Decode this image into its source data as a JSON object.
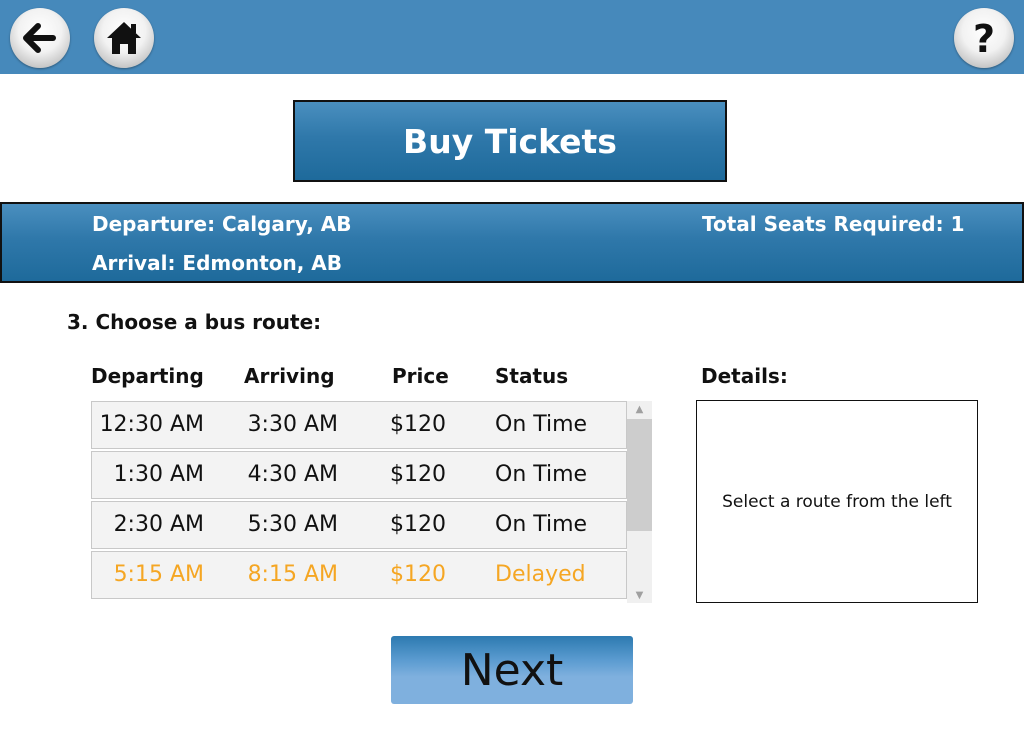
{
  "topbar": {
    "back_icon": "arrow-left-icon",
    "home_icon": "home-icon",
    "help_label": "?",
    "bar_color": "#4689bb"
  },
  "header": {
    "title": "Buy Tickets"
  },
  "trip_info": {
    "departure": "Departure: Calgary, AB",
    "arrival": "Arrival: Edmonton, AB",
    "seats": "Total Seats Required: 1"
  },
  "step": {
    "label": "3. Choose a bus route:"
  },
  "routes": {
    "columns": [
      "Departing",
      "Arriving",
      "Price",
      "Status"
    ],
    "rows": [
      {
        "departing": "12:30 AM",
        "arriving": "3:30 AM",
        "price": "$120",
        "status": "On Time"
      },
      {
        "departing": "1:30 AM",
        "arriving": "4:30 AM",
        "price": "$120",
        "status": "On Time"
      },
      {
        "departing": "2:30 AM",
        "arriving": "5:30 AM",
        "price": "$120",
        "status": "On Time"
      },
      {
        "departing": "5:15 AM",
        "arriving": "8:15 AM",
        "price": "$120",
        "status": "Delayed"
      }
    ],
    "delayed_color": "#f5a623"
  },
  "details": {
    "label": "Details:",
    "placeholder": "Select a route from the left"
  },
  "footer": {
    "next_label": "Next"
  }
}
